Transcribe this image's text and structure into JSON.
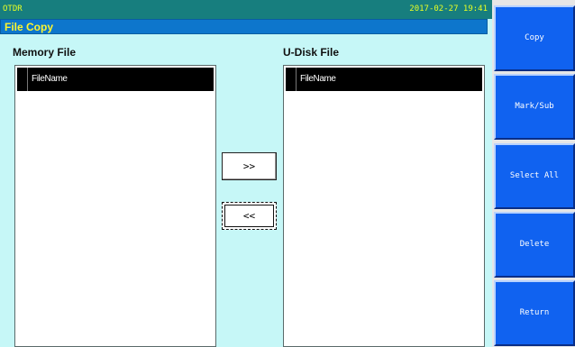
{
  "status": {
    "app": "OTDR",
    "datetime": "2017-02-27 19:41"
  },
  "title": "File Copy",
  "memory": {
    "label": "Memory File",
    "column": "FileName",
    "files": []
  },
  "udisk": {
    "label": "U-Disk File",
    "column": "FileName",
    "files": []
  },
  "transfer": {
    "to_udisk": ">>",
    "to_memory": "<<"
  },
  "softkeys": [
    "Copy",
    "Mark/Sub",
    "Select All",
    "Delete",
    "Return"
  ],
  "colors": {
    "status_bar": "#177e7e",
    "status_text": "#e8ff24",
    "title_bar": "#0d76cc",
    "title_text": "#fff62e",
    "screen_bg": "#c6f7f7",
    "softkey_bg": "#1062f0"
  }
}
